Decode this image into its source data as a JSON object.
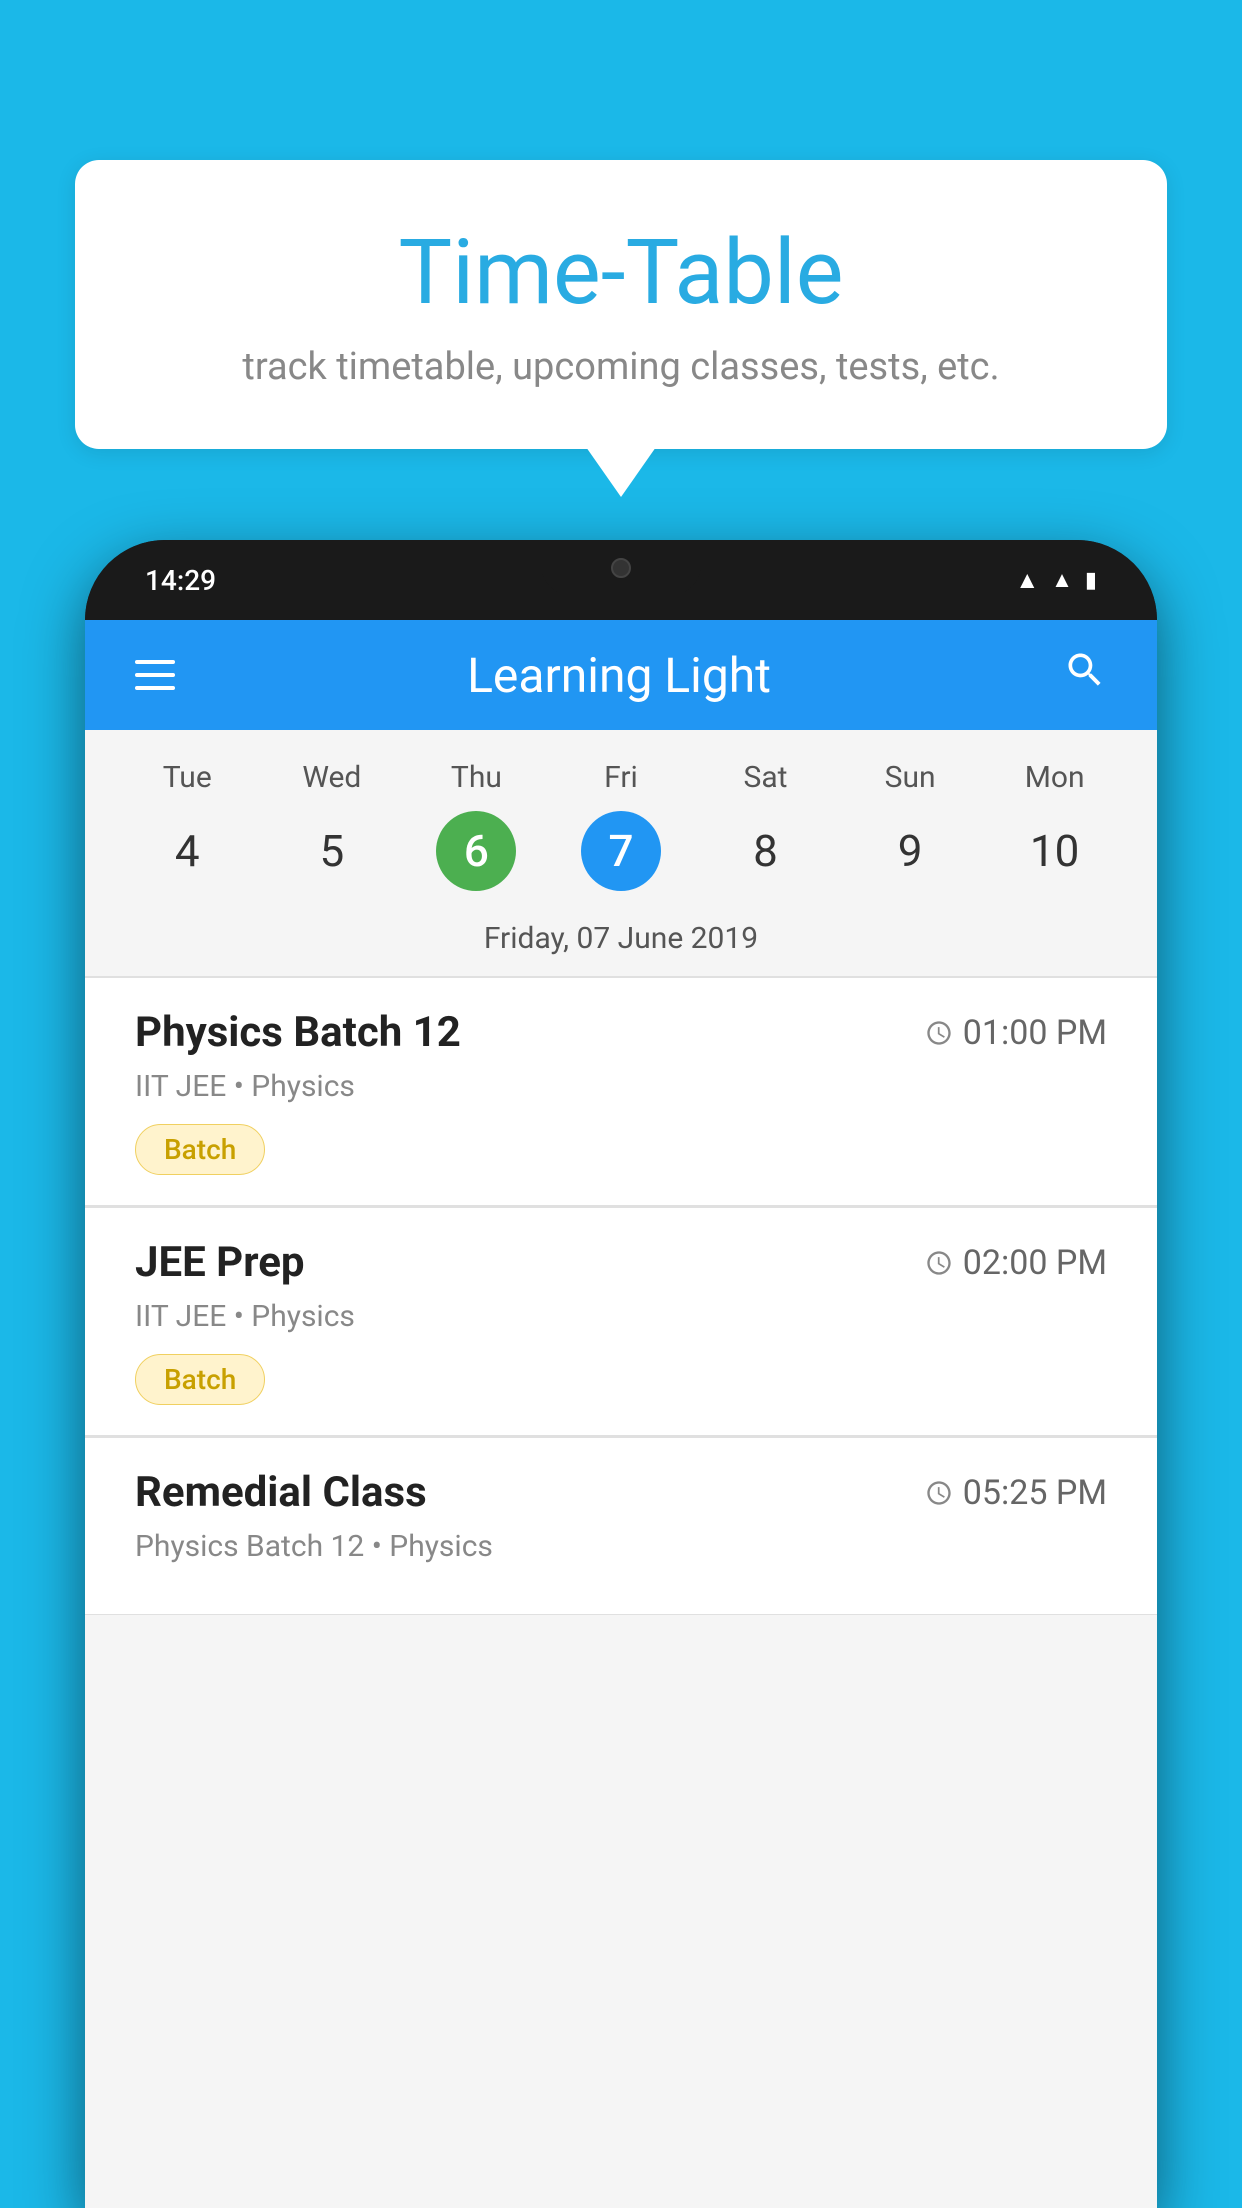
{
  "background_color": "#1BB8E8",
  "speech_bubble": {
    "title": "Time-Table",
    "subtitle": "track timetable, upcoming classes, tests, etc."
  },
  "phone": {
    "status_bar": {
      "time": "14:29",
      "icons": [
        "wifi",
        "signal",
        "battery"
      ]
    },
    "app_header": {
      "title": "Learning Light",
      "menu_label": "menu",
      "search_label": "search"
    },
    "calendar": {
      "days": [
        {
          "name": "Tue",
          "number": "4",
          "state": "normal"
        },
        {
          "name": "Wed",
          "number": "5",
          "state": "normal"
        },
        {
          "name": "Thu",
          "number": "6",
          "state": "today"
        },
        {
          "name": "Fri",
          "number": "7",
          "state": "selected"
        },
        {
          "name": "Sat",
          "number": "8",
          "state": "normal"
        },
        {
          "name": "Sun",
          "number": "9",
          "state": "normal"
        },
        {
          "name": "Mon",
          "number": "10",
          "state": "normal"
        }
      ],
      "selected_date_label": "Friday, 07 June 2019"
    },
    "schedule_items": [
      {
        "title": "Physics Batch 12",
        "time": "01:00 PM",
        "subtitle": "IIT JEE • Physics",
        "badge": "Batch",
        "badge_type": "batch"
      },
      {
        "title": "JEE Prep",
        "time": "02:00 PM",
        "subtitle": "IIT JEE • Physics",
        "badge": "Batch",
        "badge_type": "batch"
      },
      {
        "title": "Remedial Class",
        "time": "05:25 PM",
        "subtitle": "Physics Batch 12 • Physics",
        "badge": null,
        "badge_type": null
      }
    ]
  }
}
